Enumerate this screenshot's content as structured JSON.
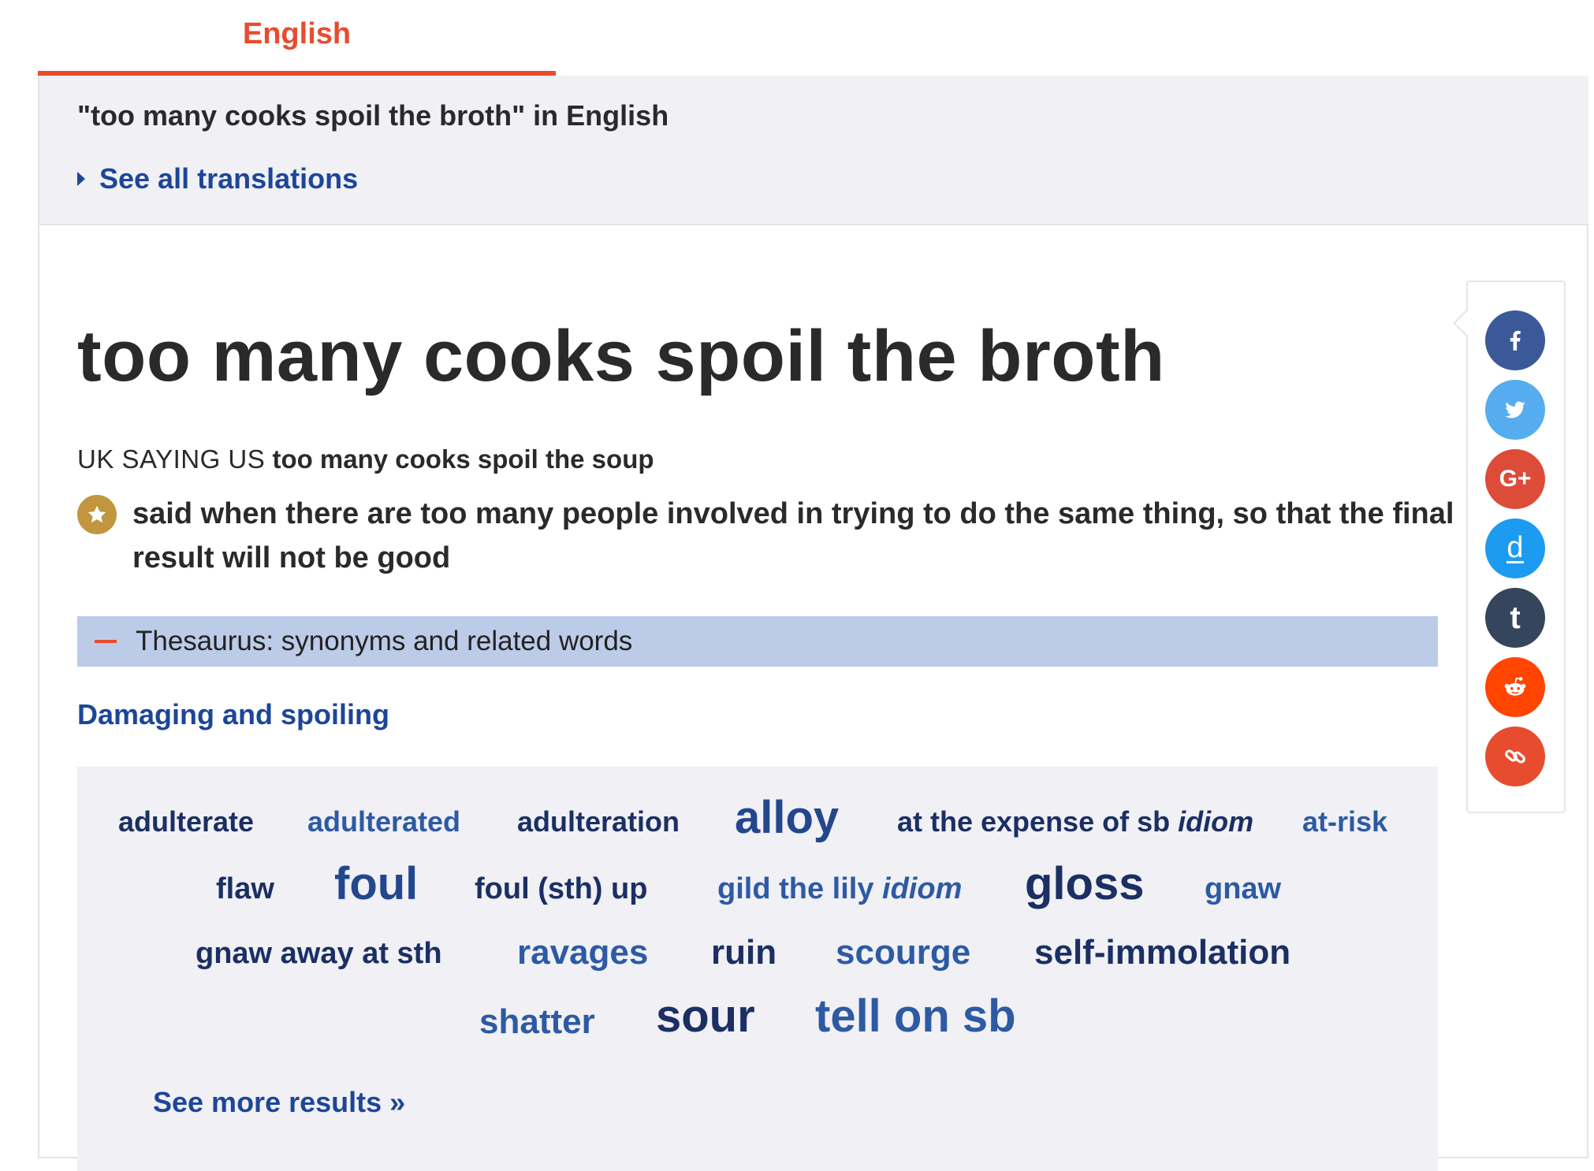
{
  "tab": {
    "label": "English"
  },
  "translations": {
    "title": "\"too many cooks spoil the broth\" in English",
    "see_all": "See all translations"
  },
  "entry": {
    "headword": "too many cooks spoil the broth",
    "labels": "UK SAYING US",
    "variant": "too many cooks spoil the soup",
    "definition": "said when there are too many people involved in trying to do the same thing, so that the final result will not be good"
  },
  "thesaurus": {
    "bar_label": "Thesaurus: synonyms and related words",
    "category": "Damaging and spoiling",
    "words": {
      "w1": "adulterate",
      "w2": "adulterated",
      "w3": "adulteration",
      "w4": "alloy",
      "w5": "at the expense of sb",
      "w5_tag": "idiom",
      "w6": "at-risk",
      "w7": "flaw",
      "w8": "foul",
      "w9": "foul (sth) up",
      "w10": "gild the lily",
      "w10_tag": "idiom",
      "w11": "gloss",
      "w12": "gnaw",
      "w13": "gnaw away at sth",
      "w14": "ravages",
      "w15": "ruin",
      "w16": "scourge",
      "w17": "self-immolation",
      "w18": "shatter",
      "w19": "sour",
      "w20": "tell on sb"
    },
    "see_more": "See more results »"
  },
  "share": {
    "facebook": {
      "icon": "facebook-icon",
      "color": "#3b5998"
    },
    "twitter": {
      "icon": "twitter-icon",
      "color": "#55acee"
    },
    "googleplus": {
      "icon": "google-plus-icon",
      "label": "G+",
      "color": "#dd4b39"
    },
    "delicious": {
      "icon": "delicious-icon",
      "label": "d",
      "color": "#1d9bf0"
    },
    "tumblr": {
      "icon": "tumblr-icon",
      "label": "t",
      "color": "#35465c"
    },
    "reddit": {
      "icon": "reddit-icon",
      "color": "#ff4500"
    },
    "link": {
      "icon": "link-icon",
      "color": "#e74c2e"
    }
  }
}
